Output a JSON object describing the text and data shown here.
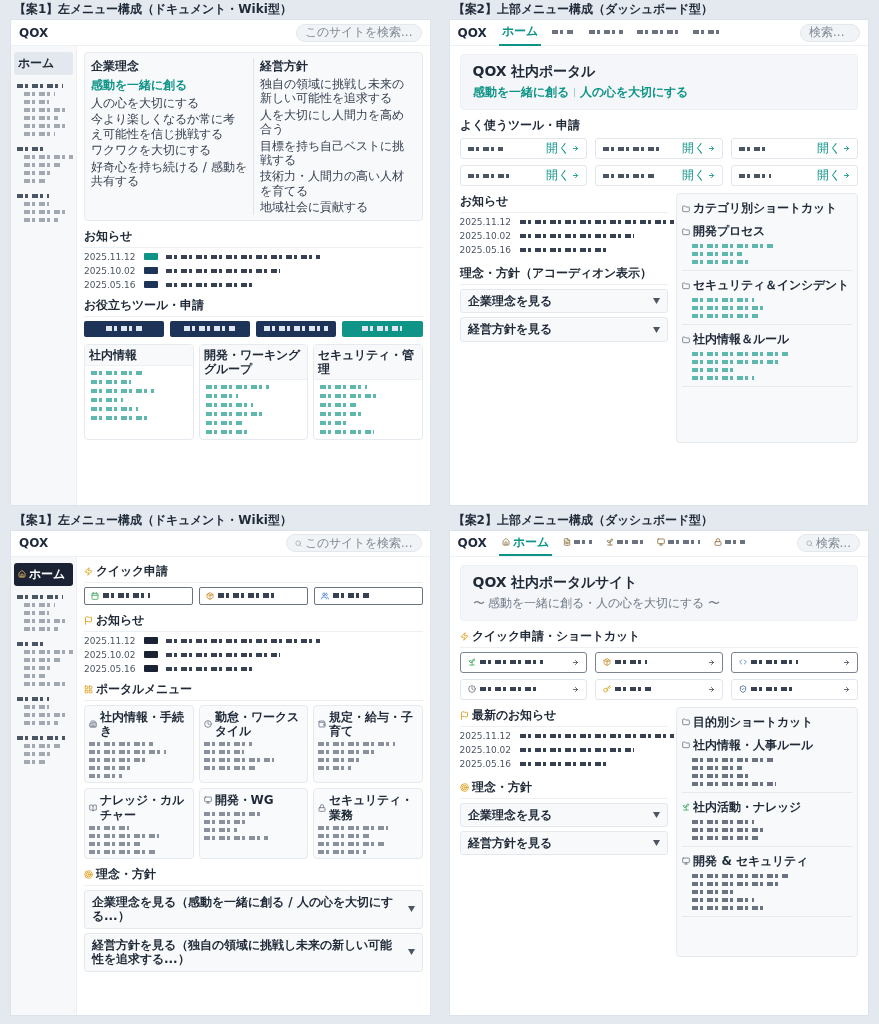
{
  "mockups": [
    {
      "kind": "wiki",
      "caption": "【案1】左メニュー構成（ドキュメント・Wiki型）",
      "logo": "QOX",
      "search": {
        "placeholder": "このサイトを検索..."
      },
      "sidebar": {
        "items": [
          {
            "label": "ホーム",
            "selected": true
          }
        ],
        "groups": [
          {
            "children": [
              {
                "kind": "blurred"
              },
              {
                "kind": "blurred"
              },
              {
                "kind": "blurred"
              },
              {
                "kind": "blurred"
              },
              {
                "kind": "blurred"
              },
              {
                "kind": "blurred"
              }
            ]
          },
          {
            "children": [
              {
                "kind": "blurred"
              },
              {
                "kind": "blurred"
              },
              {
                "kind": "blurred"
              },
              {
                "kind": "blurred"
              }
            ]
          },
          {
            "children": [
              {
                "kind": "blurred"
              },
              {
                "kind": "blurred"
              },
              {
                "kind": "blurred"
              }
            ]
          }
        ]
      },
      "philosophy": {
        "title": "企業理念",
        "motto": "感動を一緒に創る",
        "points": [
          "人の心を大切にする",
          "今より楽しくなるか常に考え可能性を信じ挑戦する",
          "ワクワクを大切にする",
          "好奇心を持ち続ける / 感動を共有する"
        ]
      },
      "policy": {
        "title": "経営方針",
        "points": [
          "独自の領域に挑戦し未来の新しい可能性を追求する",
          "人を大切にし人間力を高め合う",
          "目標を持ち自己ベストに挑戦する",
          "技術力・人間力の高い人材を育てる",
          "地域社会に貢献する"
        ]
      },
      "news": {
        "title": "お知らせ",
        "items": [
          {
            "date": "2025.11.12",
            "color": "#0f9488"
          },
          {
            "date": "2025.10.02",
            "color": "#1e3358"
          },
          {
            "date": "2025.05.16",
            "color": "#1e3358"
          }
        ]
      },
      "tools": {
        "title": "お役立ちツール・申請",
        "buttons": [
          {
            "color": "#1e3358"
          },
          {
            "color": "#1e3358"
          },
          {
            "color": "#1e3358"
          },
          {
            "color": "#0f9488"
          }
        ]
      },
      "cards": [
        {
          "title": "社内情報",
          "links": [
            {
              "kind": "blurred"
            },
            {
              "kind": "blurred"
            },
            {
              "kind": "blurred"
            },
            {
              "kind": "blurred"
            },
            {
              "kind": "blurred"
            },
            {
              "kind": "blurred"
            }
          ]
        },
        {
          "title": "開発・ワーキンググループ",
          "links": [
            {
              "kind": "blurred"
            },
            {
              "kind": "blurred"
            },
            {
              "kind": "blurred"
            },
            {
              "kind": "blurred"
            },
            {
              "kind": "blurred"
            },
            {
              "kind": "blurred"
            }
          ]
        },
        {
          "title": "セキュリティ・管理",
          "links": [
            {
              "kind": "blurred"
            },
            {
              "kind": "blurred"
            },
            {
              "kind": "blurred"
            },
            {
              "kind": "blurred"
            },
            {
              "kind": "blurred"
            },
            {
              "kind": "blurred"
            }
          ]
        }
      ]
    },
    {
      "kind": "dashboard",
      "caption": "【案2】上部メニュー構成（ダッシュボード型）",
      "logo": "QOX",
      "search": {
        "placeholder": "検索..."
      },
      "nav": [
        {
          "kind": "text",
          "label": "ホーム",
          "selected": true
        },
        {
          "kind": "blurred",
          "selected": false
        },
        {
          "kind": "blurred",
          "selected": false
        },
        {
          "kind": "blurred",
          "selected": false
        },
        {
          "kind": "blurred",
          "selected": false
        }
      ],
      "hero": {
        "title": "QOX 社内ポータル",
        "taglines": [
          "感動を一緒に創る",
          "人の心を大切にする"
        ]
      },
      "tools": {
        "title": "よく使うツール・申請",
        "tiles": [
          {
            "action": "開く"
          },
          {
            "action": "開く"
          },
          {
            "action": "開く"
          },
          {
            "action": "開く"
          },
          {
            "action": "開く"
          },
          {
            "action": "開く"
          }
        ]
      },
      "news": {
        "title": "お知らせ",
        "items": [
          {
            "date": "2025.11.12"
          },
          {
            "date": "2025.10.02"
          },
          {
            "date": "2025.05.16"
          }
        ]
      },
      "accordion": {
        "title": "理念・方針（アコーディオン表示）",
        "items": [
          {
            "label": "企業理念を見る",
            "expanded": false
          },
          {
            "label": "経営方針を見る",
            "expanded": false
          }
        ]
      },
      "shortcuts": {
        "title": "カテゴリ別ショートカット",
        "groups": [
          {
            "title": "開発プロセス",
            "links": [
              {
                "kind": "blurred"
              },
              {
                "kind": "blurred"
              },
              {
                "kind": "blurred"
              }
            ]
          },
          {
            "title": "セキュリティ＆インシデント",
            "links": [
              {
                "kind": "blurred"
              },
              {
                "kind": "blurred"
              },
              {
                "kind": "blurred"
              }
            ]
          },
          {
            "title": "社内情報＆ルール",
            "links": [
              {
                "kind": "blurred"
              },
              {
                "kind": "blurred"
              },
              {
                "kind": "blurred"
              },
              {
                "kind": "blurred"
              }
            ]
          }
        ]
      }
    },
    {
      "kind": "wikiplus",
      "caption": "【案1】左メニュー構成（ドキュメント・Wiki型）",
      "logo": "QOX",
      "search": {
        "placeholder": "このサイトを検索..."
      },
      "sidebar": {
        "items": [
          {
            "label": "ホーム",
            "selected": true
          }
        ],
        "groups": [
          {
            "children": [
              {
                "kind": "blurred"
              },
              {
                "kind": "blurred"
              },
              {
                "kind": "blurred"
              },
              {
                "kind": "blurred"
              }
            ]
          },
          {
            "children": [
              {
                "kind": "blurred"
              },
              {
                "kind": "blurred"
              },
              {
                "kind": "blurred"
              },
              {
                "kind": "blurred"
              },
              {
                "kind": "blurred"
              }
            ]
          },
          {
            "children": [
              {
                "kind": "blurred"
              },
              {
                "kind": "blurred"
              },
              {
                "kind": "blurred"
              }
            ]
          },
          {
            "children": [
              {
                "kind": "blurred"
              },
              {
                "kind": "blurred"
              },
              {
                "kind": "blurred"
              }
            ]
          }
        ]
      },
      "quick": {
        "title": "クイック申請",
        "buttons": [
          {
            "kind": "blurred"
          },
          {
            "kind": "blurred"
          },
          {
            "kind": "blurred"
          }
        ]
      },
      "news": {
        "title": "お知らせ",
        "items": [
          {
            "date": "2025.11.12",
            "color": "#1a2233"
          },
          {
            "date": "2025.10.02",
            "color": "#1a2233"
          },
          {
            "date": "2025.05.16",
            "color": "#1a2233"
          }
        ]
      },
      "portal": {
        "title": "ポータルメニュー",
        "cards": [
          {
            "title": "社内情報・手続き",
            "links": [
              {
                "kind": "blurred"
              },
              {
                "kind": "blurred"
              },
              {
                "kind": "blurred"
              },
              {
                "kind": "blurred"
              },
              {
                "kind": "blurred"
              }
            ]
          },
          {
            "title": "勤怠・ワークスタイル",
            "links": [
              {
                "kind": "blurred"
              },
              {
                "kind": "blurred"
              },
              {
                "kind": "blurred"
              },
              {
                "kind": "blurred"
              }
            ]
          },
          {
            "title": "規定・給与・子育て",
            "links": [
              {
                "kind": "blurred"
              },
              {
                "kind": "blurred"
              },
              {
                "kind": "blurred"
              },
              {
                "kind": "blurred"
              }
            ]
          },
          {
            "title": "ナレッジ・カルチャー",
            "links": [
              {
                "kind": "blurred"
              },
              {
                "kind": "blurred"
              },
              {
                "kind": "blurred"
              },
              {
                "kind": "blurred"
              }
            ]
          },
          {
            "title": "開発・WG",
            "links": [
              {
                "kind": "blurred"
              },
              {
                "kind": "blurred"
              },
              {
                "kind": "blurred"
              },
              {
                "kind": "blurred"
              }
            ]
          },
          {
            "title": "セキュリティ・業務",
            "links": [
              {
                "kind": "blurred"
              },
              {
                "kind": "blurred"
              },
              {
                "kind": "blurred"
              },
              {
                "kind": "blurred"
              }
            ]
          }
        ]
      },
      "accordion": {
        "title": "理念・方針",
        "items": [
          {
            "label": "企業理念を見る（感動を一緒に創る / 人の心を大切にする...）",
            "expanded": false
          },
          {
            "label": "経営方針を見る（独自の領域に挑戦し未来の新しい可能性を追求する...）",
            "expanded": false
          }
        ]
      }
    },
    {
      "kind": "dashboardplus",
      "caption": "【案2】上部メニュー構成（ダッシュボード型）",
      "logo": "QOX",
      "search": {
        "placeholder": "検索..."
      },
      "nav": [
        {
          "kind": "text",
          "label": "ホーム",
          "selected": true
        },
        {
          "kind": "blurred",
          "selected": false
        },
        {
          "kind": "blurred",
          "selected": false
        },
        {
          "kind": "blurred",
          "selected": false
        },
        {
          "kind": "blurred",
          "selected": false
        }
      ],
      "hero": {
        "title": "QOX 社内ポータルサイト",
        "subtitle": "〜 感動を一緒に創る・人の心を大切にする 〜"
      },
      "quick": {
        "title": "クイック申請・ショートカット",
        "tiles": [
          {
            "kind": "outlined"
          },
          {
            "kind": "outlined"
          },
          {
            "kind": "outlined"
          },
          {
            "kind": "plain"
          },
          {
            "kind": "plain"
          },
          {
            "kind": "plain"
          }
        ]
      },
      "news": {
        "title": "最新のお知らせ",
        "items": [
          {
            "date": "2025.11.12"
          },
          {
            "date": "2025.10.02"
          },
          {
            "date": "2025.05.16"
          }
        ]
      },
      "accordion": {
        "title": "理念・方針",
        "items": [
          {
            "label": "企業理念を見る",
            "expanded": false
          },
          {
            "label": "経営方針を見る",
            "expanded": false
          }
        ]
      },
      "shortcuts": {
        "title": "目的別ショートカット",
        "groups": [
          {
            "title": "社内情報・人事ルール",
            "links": [
              {
                "kind": "blurred"
              },
              {
                "kind": "blurred"
              },
              {
                "kind": "blurred"
              },
              {
                "kind": "blurred"
              }
            ]
          },
          {
            "title": "社内活動・ナレッジ",
            "links": [
              {
                "kind": "blurred"
              },
              {
                "kind": "blurred"
              },
              {
                "kind": "blurred"
              }
            ]
          },
          {
            "title": "開発 & セキュリティ",
            "links": [
              {
                "kind": "blurred"
              },
              {
                "kind": "blurred"
              },
              {
                "kind": "blurred"
              },
              {
                "kind": "blurred"
              },
              {
                "kind": "blurred"
              }
            ]
          }
        ]
      }
    }
  ]
}
